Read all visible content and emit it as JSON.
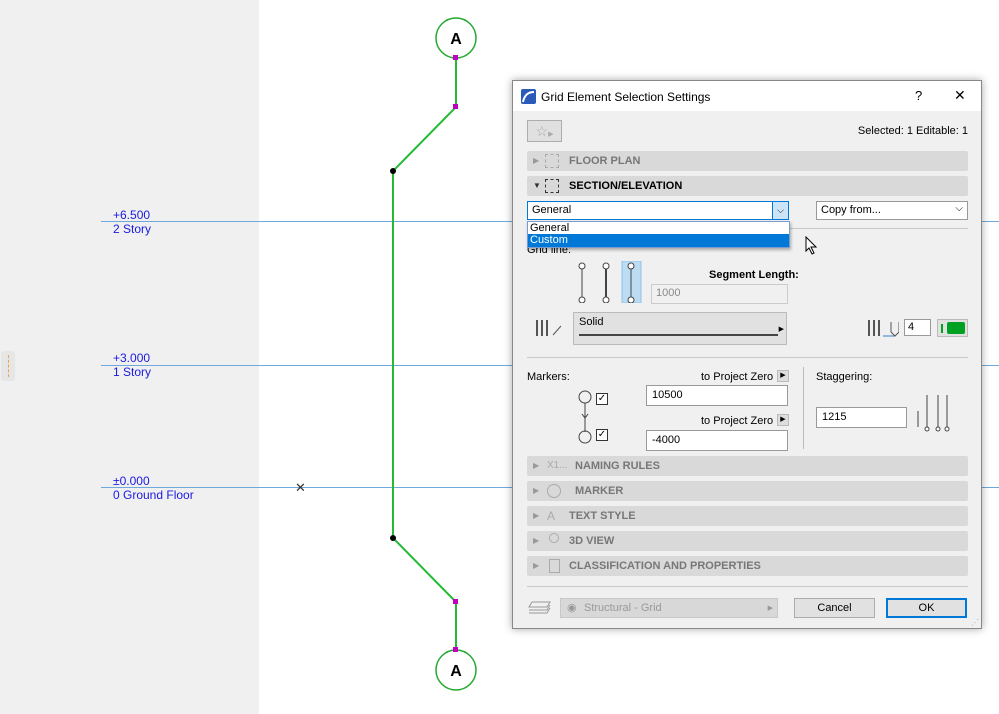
{
  "canvas": {
    "levels": [
      {
        "elevation": "+6.500",
        "name": "2 Story"
      },
      {
        "elevation": "+3.000",
        "name": "1 Story"
      },
      {
        "elevation": "±0.000",
        "name": "0 Ground Floor"
      }
    ],
    "grid_marker_label": "A",
    "grid_color": "#22bb33",
    "level_line_color": "#6fa8dc",
    "level_text_color": "#1a1ae0"
  },
  "dialog": {
    "title": "Grid Element Selection Settings",
    "help_label": "?",
    "close_label": "✕",
    "selection_info": "Selected: 1 Editable: 1",
    "sections": {
      "floor_plan": "FLOOR PLAN",
      "section_elevation": "SECTION/ELEVATION",
      "naming_rules": "NAMING RULES",
      "naming_rules_icon_text": "X1...",
      "marker": "MARKER",
      "text_style": "TEXT STYLE",
      "view_3d": "3D VIEW",
      "classification": "CLASSIFICATION AND PROPERTIES"
    },
    "mode_select": {
      "value": "General",
      "options": [
        "General",
        "Custom"
      ],
      "highlighted": "Custom"
    },
    "copy_from": "Copy from...",
    "grid_line_label": "Grid line:",
    "segment_length_label": "Segment Length:",
    "segment_length_value": "1000",
    "line_type": "Solid",
    "pen_number": "4",
    "pen_color": "#00a020",
    "markers_label": "Markers:",
    "to_project_zero_1": "to Project Zero",
    "marker_top_value": "10500",
    "to_project_zero_2": "to Project Zero",
    "marker_bottom_value": "-4000",
    "marker_top_checked": true,
    "marker_bottom_checked": true,
    "staggering_label": "Staggering:",
    "staggering_value": "1215",
    "layer": "Structural - Grid",
    "cancel": "Cancel",
    "ok": "OK",
    "accent": "#0078d7"
  }
}
